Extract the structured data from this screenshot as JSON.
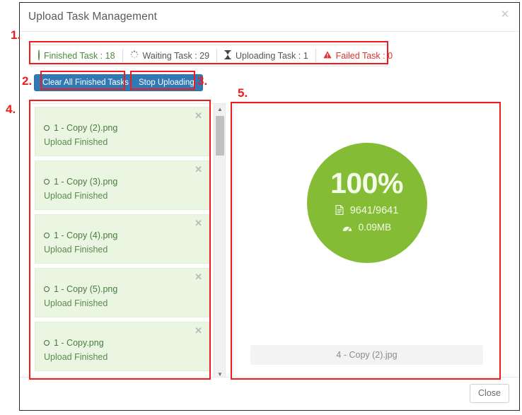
{
  "dialog": {
    "title": "Upload Task Management",
    "close_icon": "close-icon",
    "footer": {
      "close_label": "Close"
    }
  },
  "status_bar": {
    "items": [
      {
        "icon": "circle-outline-icon",
        "label": "Finished Task : 18",
        "color": "#4b8b3b"
      },
      {
        "icon": "spinner-icon",
        "label": "Waiting Task : 29",
        "color": "#555555"
      },
      {
        "icon": "hourglass-icon",
        "label": "Uploading Task : 1",
        "color": "#555555"
      },
      {
        "icon": "warning-triangle-icon",
        "label": "Failed Task : 0",
        "color": "#d9332d"
      }
    ]
  },
  "toolbar": {
    "clear_all_finished_label": "Clear All Finished Tasks",
    "stop_uploading_label": "Stop Uploading",
    "button_color": "#3079b5"
  },
  "task_list": {
    "items": [
      {
        "name": "1 - Copy (2).png",
        "status": "Upload Finished",
        "close_icon": "close-icon"
      },
      {
        "name": "1 - Copy (3).png",
        "status": "Upload Finished",
        "close_icon": "close-icon"
      },
      {
        "name": "1 - Copy (4).png",
        "status": "Upload Finished",
        "close_icon": "close-icon"
      },
      {
        "name": "1 - Copy (5).png",
        "status": "Upload Finished",
        "close_icon": "close-icon"
      },
      {
        "name": "1 - Copy.png",
        "status": "Upload Finished",
        "close_icon": "close-icon"
      }
    ],
    "item_background": "#eaf6e2",
    "item_text_color": "#4a7a3e",
    "scrollbar": {
      "up_arrow_icon": "chevron-up-icon",
      "down_arrow_icon": "chevron-down-icon"
    }
  },
  "progress": {
    "percent": "100%",
    "count": "9641/9641",
    "count_icon": "file-icon",
    "size": "0.09MB",
    "size_icon": "tachometer-icon",
    "circle_color": "#84bd35",
    "current_file": "4 - Copy (2).jpg"
  },
  "annotations": [
    {
      "number": "1."
    },
    {
      "number": "2."
    },
    {
      "number": "3."
    },
    {
      "number": "4."
    },
    {
      "number": "5."
    }
  ]
}
